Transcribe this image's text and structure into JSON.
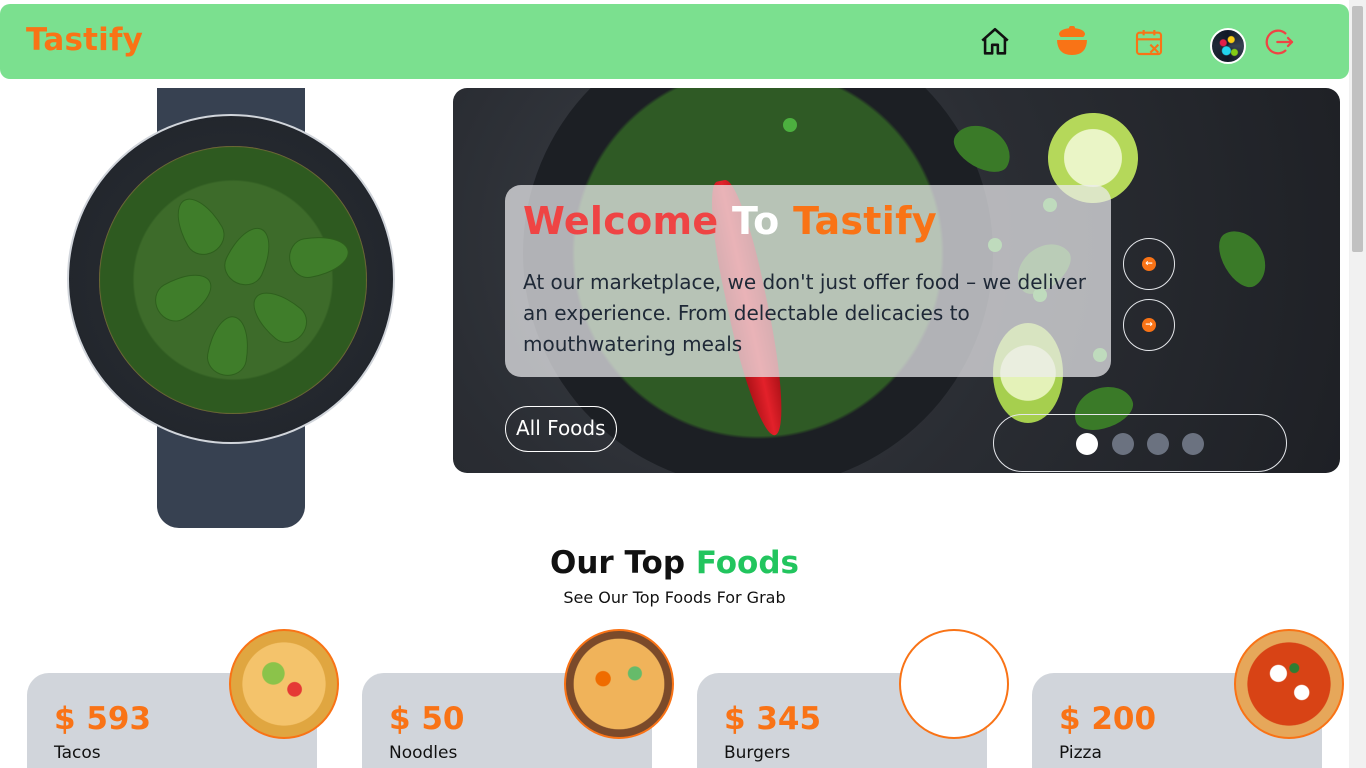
{
  "header": {
    "brand": "Tastify"
  },
  "hero": {
    "title_part1": "Welcome",
    "title_part2": "To",
    "title_part3": "Tastify",
    "description": "At our marketplace, we don't just offer food – we deliver an experience. From delectable delicacies to mouthwatering meals",
    "all_foods_label": "All Foods",
    "slides": {
      "count": 4,
      "active_index": 0
    }
  },
  "section": {
    "title_part1": "Our Top",
    "title_part2": "Foods",
    "subtitle": "See Our Top Foods For Grab"
  },
  "foods": [
    {
      "price": "$ 593",
      "name": "Tacos"
    },
    {
      "price": "$ 50",
      "name": "Noodles"
    },
    {
      "price": "$ 345",
      "name": "Burgers"
    },
    {
      "price": "$ 200",
      "name": "Pizza"
    }
  ],
  "colors": {
    "header_bg": "#7be08f",
    "brand": "#f97316",
    "title_red": "#ef4444",
    "accent_green": "#22c55e",
    "card_bg": "#d1d5db"
  },
  "icons": {
    "home": "home-icon",
    "pot": "cooking-pot-icon",
    "calendar": "calendar-icon",
    "logout": "logout-icon"
  }
}
